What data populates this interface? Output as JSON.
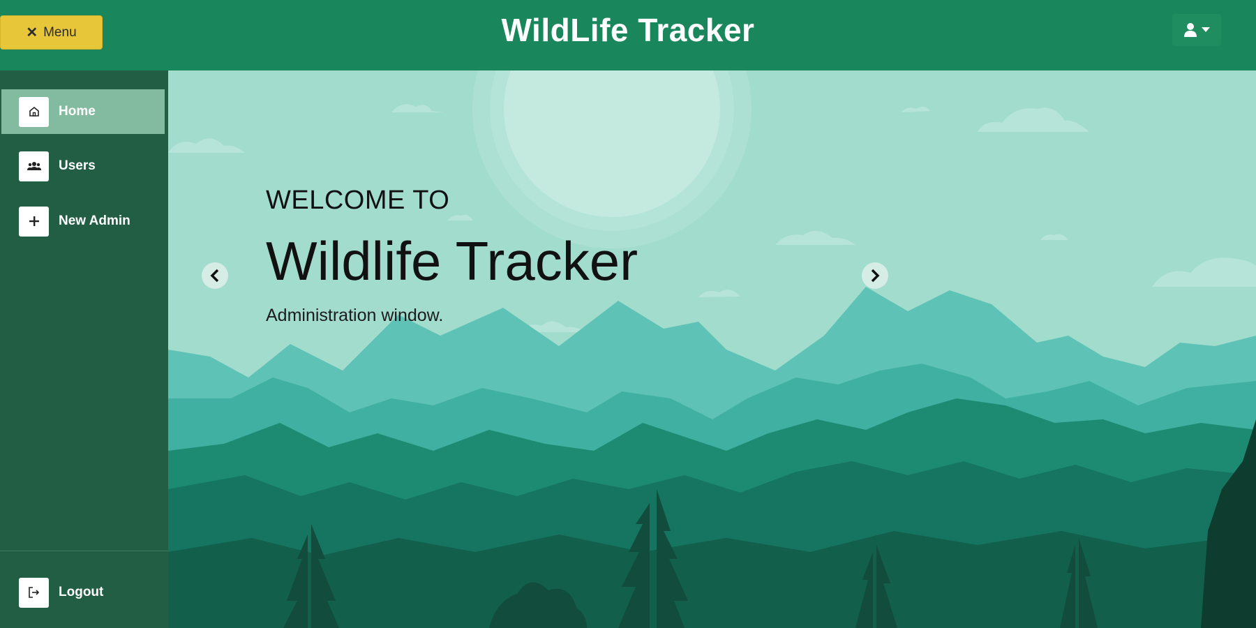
{
  "header": {
    "menu_label": "Menu",
    "title": "WildLife Tracker",
    "user_icon": "user-dropdown-icon"
  },
  "sidebar": {
    "items": [
      {
        "label": "Home",
        "icon": "home-icon",
        "active": true
      },
      {
        "label": "Users",
        "icon": "users-icon",
        "active": false
      },
      {
        "label": "New Admin",
        "icon": "plus-icon",
        "active": false
      }
    ],
    "logout": {
      "label": "Logout",
      "icon": "logout-icon"
    }
  },
  "hero": {
    "welcome": "WELCOME TO",
    "title": "Wildlife Tracker",
    "subtitle": "Administration window."
  },
  "colors": {
    "navbar": "#19875b",
    "sidebar": "#215e43",
    "menu_button": "#e7c63a",
    "active_item": "#82bba0",
    "sky": "#a2dccd"
  }
}
